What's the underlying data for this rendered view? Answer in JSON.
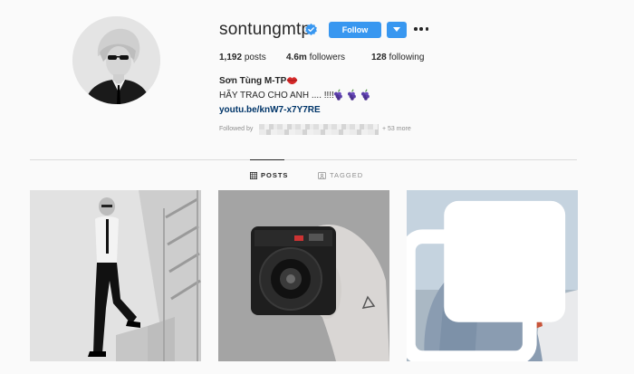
{
  "profile": {
    "username": "sontungmtp",
    "follow_label": "Follow",
    "full_name": "Sơn Tùng M-TP",
    "bio": "HÃY TRAO CHO ANH .... !!!!",
    "link": "youtu.be/knW7-x7Y7RE",
    "followed_by_label": "Followed by",
    "followed_by_more": "+ 53 more"
  },
  "stats": {
    "posts": {
      "count": "1,192",
      "label": "posts"
    },
    "followers": {
      "count": "4.6m",
      "label": "followers"
    },
    "following": {
      "count": "128",
      "label": "following"
    }
  },
  "tabs": [
    {
      "label": "POSTS",
      "active": true
    },
    {
      "label": "TAGGED",
      "active": false
    }
  ],
  "posts": [
    {
      "description_icon": "photo-icon"
    },
    {
      "description_icon": "photo-icon"
    },
    {
      "description_icon": "carousel-icon"
    }
  ],
  "colors": {
    "accent": "#3897f0",
    "link": "#003569",
    "muted": "#8e8e8e",
    "divider": "#dbdbdb"
  }
}
